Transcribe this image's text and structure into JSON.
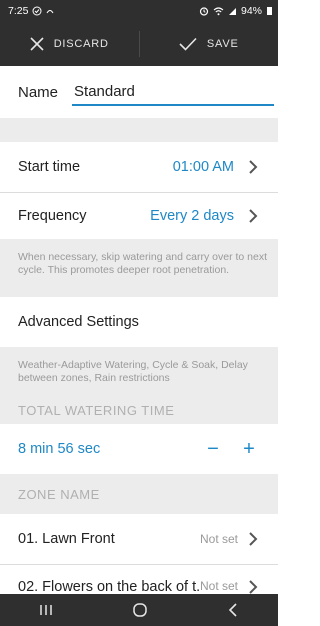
{
  "status_bar": {
    "time": "7:25",
    "battery": "94%"
  },
  "action_bar": {
    "discard_label": "DISCARD",
    "save_label": "SAVE"
  },
  "name": {
    "label": "Name",
    "value": "Standard"
  },
  "start_time": {
    "label": "Start time",
    "value": "01:00 AM"
  },
  "frequency": {
    "label": "Frequency",
    "value": "Every 2 days",
    "note": "When necessary, skip watering and carry over to next cycle. This promotes deeper root penetration."
  },
  "advanced": {
    "label": "Advanced Settings",
    "note": "Weather-Adaptive Watering, Cycle & Soak, Delay between zones, Rain restrictions"
  },
  "total_watering": {
    "header": "TOTAL WATERING TIME",
    "value": "8 min 56 sec",
    "minus": "−",
    "plus": "+"
  },
  "zones": {
    "header": "ZONE NAME",
    "items": [
      {
        "name": "01. Lawn Front",
        "status": "Not set"
      },
      {
        "name": "02. Flowers on the back of t...",
        "status": "Not set"
      }
    ]
  },
  "colors": {
    "accent": "#1e88c7",
    "dark_bar": "#2f2f2f",
    "band": "#ececec"
  }
}
